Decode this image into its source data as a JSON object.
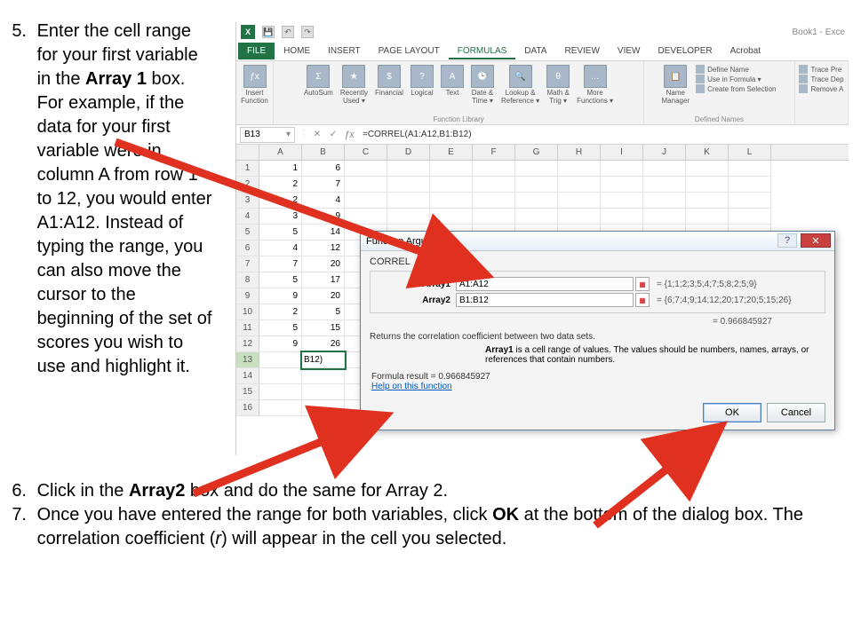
{
  "instructions": {
    "step5_num": "5.",
    "step5_pre": "Enter the cell range for your first variable in the ",
    "step5_bold1": "Array 1",
    "step5_post": " box. For example, if the data for your first variable were in column A from row 1 to 12, you would enter A1:A12. Instead of typing the range, you can also move the cursor to the beginning of the set of scores you wish to use and highlight it.",
    "step6_num": "6.",
    "step6_pre": "Click in the ",
    "step6_bold": "Array2",
    "step6_post": " box and do the same for Array 2.",
    "step7_num": "7.",
    "step7_pre": "Once you have entered the range for both variables, click ",
    "step7_bold": "OK",
    "step7_mid": " at the bottom of the dialog box. The correlation coefficient (",
    "step7_italic": "r",
    "step7_post": ") will appear in the cell you selected."
  },
  "excel": {
    "qat": {
      "save": "💾",
      "undo": "↶",
      "redo": "↷"
    },
    "book_title": "Book1 - Exce",
    "tabs": [
      "FILE",
      "HOME",
      "INSERT",
      "PAGE LAYOUT",
      "FORMULAS",
      "DATA",
      "REVIEW",
      "VIEW",
      "DEVELOPER",
      "Acrobat"
    ],
    "ribbon": {
      "insert_function": "Insert\nFunction",
      "fx": "ƒx",
      "autosum": "AutoSum",
      "recently_used": "Recently\nUsed ▾",
      "financial": "Financial",
      "logical": "Logical",
      "text": "Text",
      "date_time": "Date &\nTime ▾",
      "lookup_ref": "Lookup &\nReference ▾",
      "math_trig": "Math &\nTrig ▾",
      "more_functions": "More\nFunctions ▾",
      "function_library": "Function Library",
      "name_manager": "Name\nManager",
      "define_name": "Define Name",
      "use_in_formula": "Use in Formula ▾",
      "create_from_selection": "Create from Selection",
      "defined_names": "Defined Names",
      "trace_pre": "Trace Pre",
      "trace_dep": "Trace Dep",
      "remove_a": "Remove A"
    },
    "namebox": "B13",
    "fb_cancel": "✕",
    "fb_enter": "✓",
    "fb_fx": "ƒx",
    "formula": "=CORREL(A1:A12,B1:B12)",
    "columns": [
      "A",
      "B",
      "C",
      "D",
      "E",
      "F",
      "G",
      "H",
      "I",
      "J",
      "K",
      "L"
    ],
    "rows": [
      {
        "n": "1",
        "a": "1",
        "b": "6"
      },
      {
        "n": "2",
        "a": "2",
        "b": "7"
      },
      {
        "n": "3",
        "a": "2",
        "b": "4"
      },
      {
        "n": "4",
        "a": "3",
        "b": "9"
      },
      {
        "n": "5",
        "a": "5",
        "b": "14"
      },
      {
        "n": "6",
        "a": "4",
        "b": "12"
      },
      {
        "n": "7",
        "a": "7",
        "b": "20"
      },
      {
        "n": "8",
        "a": "5",
        "b": "17"
      },
      {
        "n": "9",
        "a": "9",
        "b": "20"
      },
      {
        "n": "10",
        "a": "2",
        "b": "5"
      },
      {
        "n": "11",
        "a": "5",
        "b": "15"
      },
      {
        "n": "12",
        "a": "9",
        "b": "26"
      },
      {
        "n": "13",
        "a": "",
        "b": "B12)"
      },
      {
        "n": "14",
        "a": "",
        "b": ""
      },
      {
        "n": "15",
        "a": "",
        "b": ""
      },
      {
        "n": "16",
        "a": "",
        "b": ""
      }
    ]
  },
  "dialog": {
    "title": "Function Arguments",
    "fn_name": "CORREL",
    "arg1_label": "Array1",
    "arg1_value": "A1:A12",
    "arg1_result": "= {1;1;2;3;5;4;7;5;8;2;5;9}",
    "arg2_label": "Array2",
    "arg2_value": "B1:B12",
    "arg2_result": "= {6;7;4;9;14;12;20;17;20;5;15;26}",
    "result_eq": "= 0.966845927",
    "desc": "Returns the correlation coefficient between two data sets.",
    "argdesc_label": "Array1",
    "argdesc_text": " is a cell range of values. The values should be numbers, names, arrays, or references that contain numbers.",
    "formula_result_label": "Formula result = ",
    "formula_result_value": "0.966845927",
    "help_link": "Help on this function",
    "ok": "OK",
    "cancel": "Cancel",
    "help_btn": "?",
    "close_btn": "✕"
  }
}
